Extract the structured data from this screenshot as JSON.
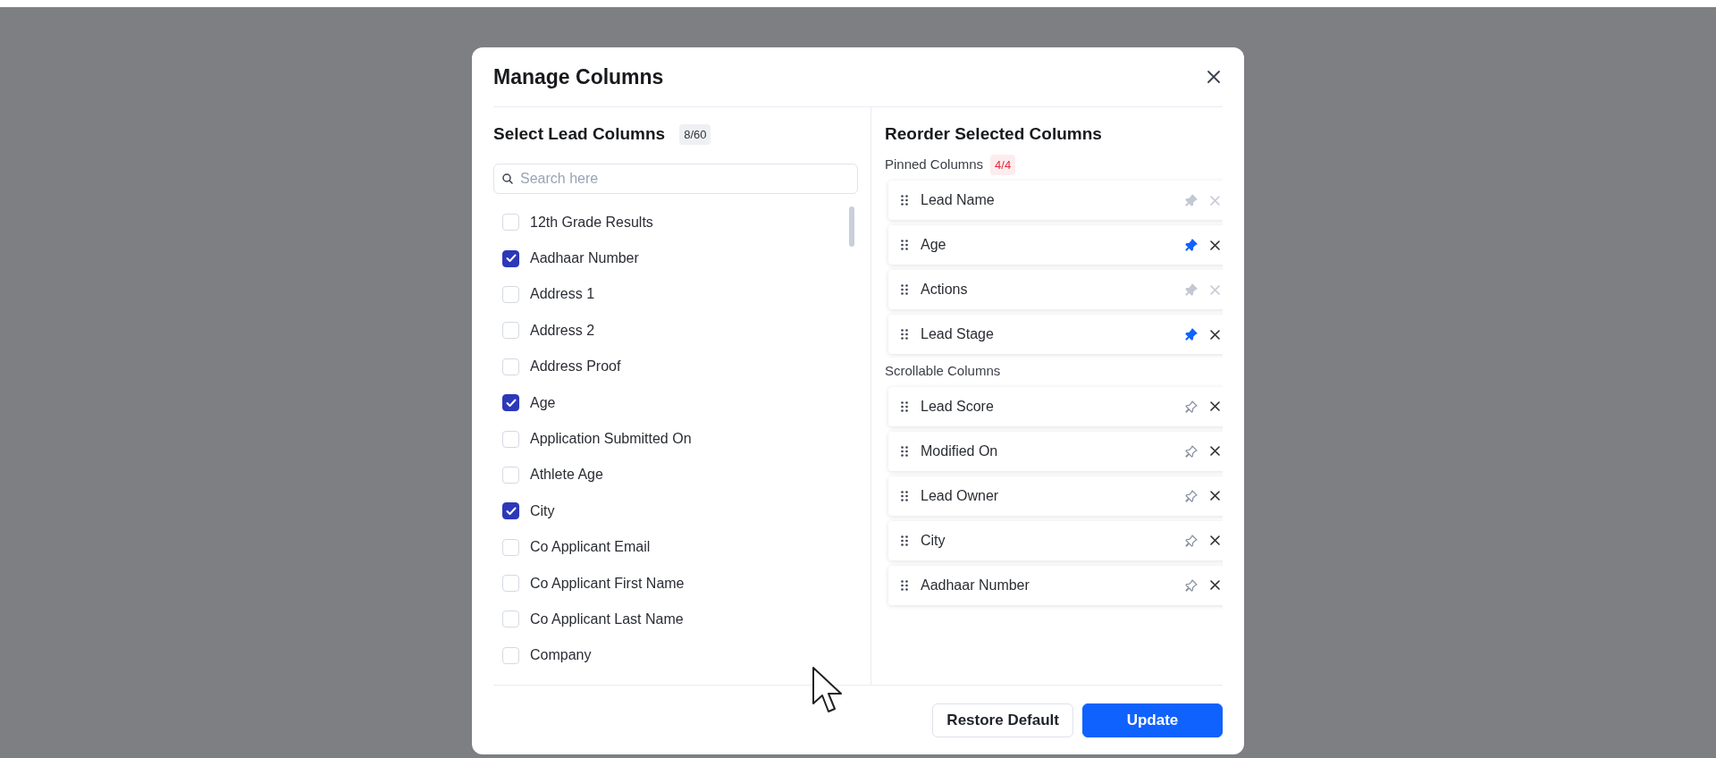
{
  "dialog": {
    "title": "Manage Columns"
  },
  "select_panel": {
    "title": "Select Lead Columns",
    "count": "8/60",
    "search": {
      "placeholder": "Search here"
    },
    "options": [
      {
        "label": "12th Grade Results",
        "checked": false
      },
      {
        "label": "Aadhaar Number",
        "checked": true
      },
      {
        "label": "Address 1",
        "checked": false
      },
      {
        "label": "Address 2",
        "checked": false
      },
      {
        "label": "Address Proof",
        "checked": false
      },
      {
        "label": "Age",
        "checked": true
      },
      {
        "label": "Application Submitted On",
        "checked": false
      },
      {
        "label": "Athlete Age",
        "checked": false
      },
      {
        "label": "City",
        "checked": true
      },
      {
        "label": "Co Applicant Email",
        "checked": false
      },
      {
        "label": "Co Applicant First Name",
        "checked": false
      },
      {
        "label": "Co Applicant Last Name",
        "checked": false
      },
      {
        "label": "Company",
        "checked": false
      }
    ]
  },
  "reorder_panel": {
    "title": "Reorder Selected Columns",
    "groups": [
      {
        "label": "Pinned Columns",
        "count": "4/4",
        "items": [
          {
            "label": "Lead Name",
            "pinned": true,
            "disabled": true
          },
          {
            "label": "Age",
            "pinned": true,
            "disabled": false
          },
          {
            "label": "Actions",
            "pinned": true,
            "disabled": true
          },
          {
            "label": "Lead Stage",
            "pinned": true,
            "disabled": false
          }
        ]
      },
      {
        "label": "Scrollable Columns",
        "items": [
          {
            "label": "Lead Score",
            "pinned": false,
            "disabled": false
          },
          {
            "label": "Modified On",
            "pinned": false,
            "disabled": false
          },
          {
            "label": "Lead Owner",
            "pinned": false,
            "disabled": false
          },
          {
            "label": "City",
            "pinned": false,
            "disabled": false
          },
          {
            "label": "Aadhaar Number",
            "pinned": false,
            "disabled": false
          }
        ]
      }
    ]
  },
  "footer": {
    "buttons": [
      {
        "label": "Restore Default",
        "kind": "secondary"
      },
      {
        "label": "Update",
        "kind": "primary"
      }
    ]
  }
}
